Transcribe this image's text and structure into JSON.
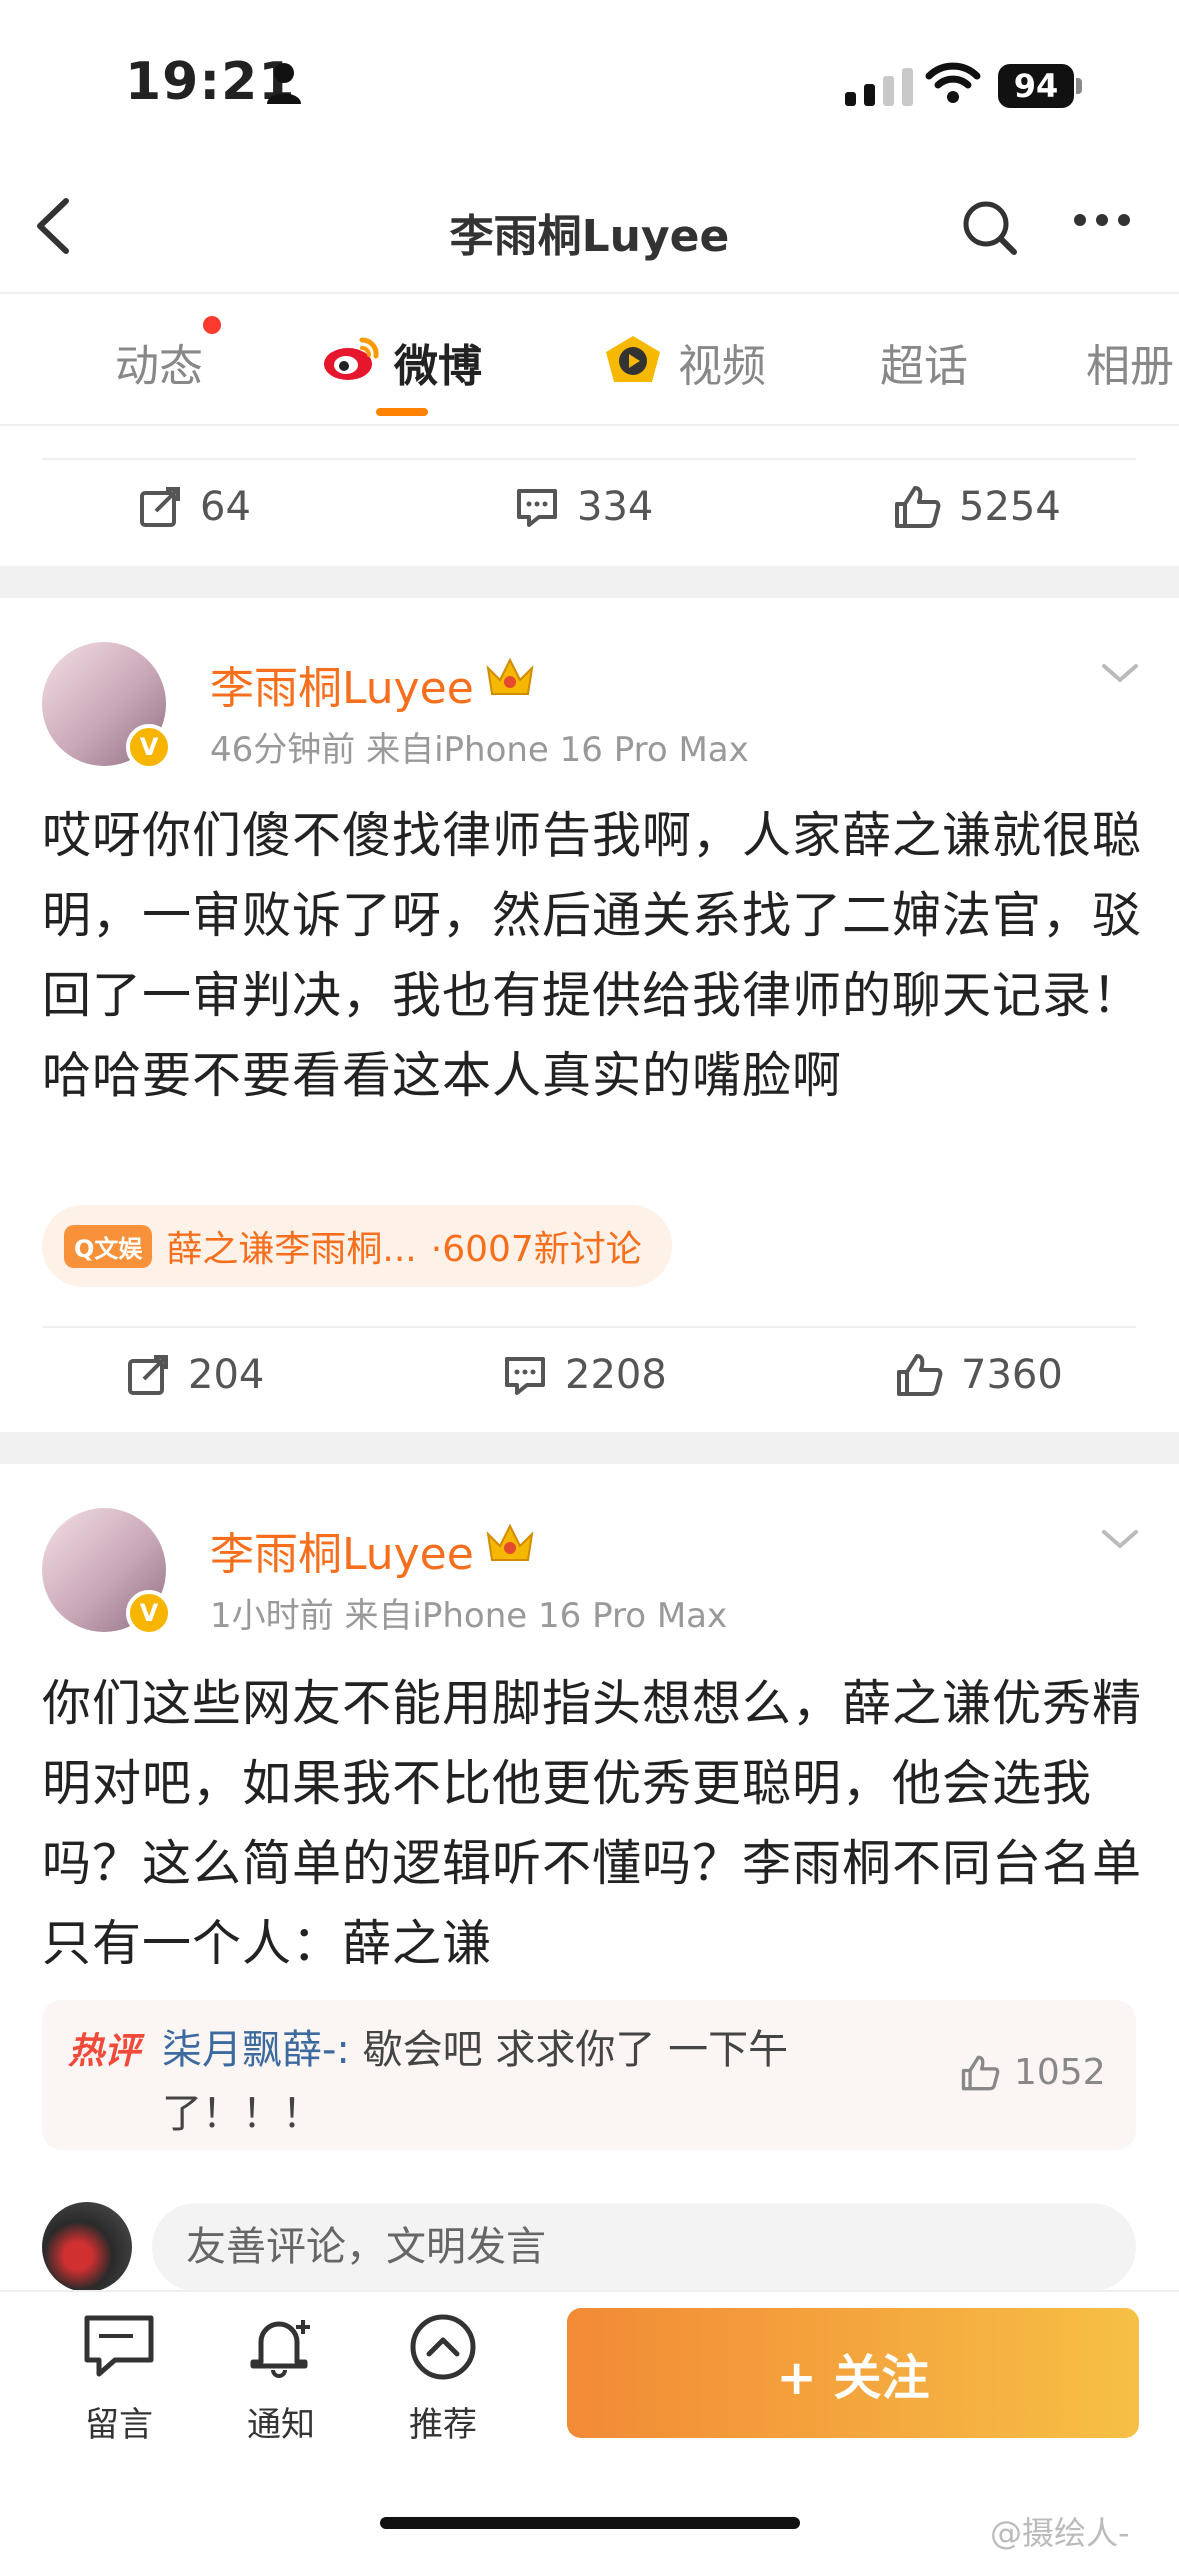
{
  "status_bar": {
    "time": "19:21",
    "battery": "94"
  },
  "nav": {
    "title": "李雨桐Luyee"
  },
  "tabs": [
    {
      "label": "动态"
    },
    {
      "label": "微博"
    },
    {
      "label": "视频"
    },
    {
      "label": "超话"
    },
    {
      "label": "相册"
    }
  ],
  "prev_post": {
    "reposts": "64",
    "comments": "334",
    "likes": "5254"
  },
  "post1": {
    "username": "李雨桐Luyee",
    "meta": "46分钟前  来自iPhone 16 Pro Max",
    "text": "哎呀你们傻不傻找律师告我啊，人家薛之谦就很聪明，一审败诉了呀，然后通关系找了二婶法官，驳回了一审判决，我也有提供给我律师的聊天记录！哈哈要不要看看这本人真实的嘴脸啊",
    "topic_tag": "Q文娱",
    "topic_title": "薛之谦李雨桐...",
    "topic_count": "·6007新讨论",
    "reposts": "204",
    "comments": "2208",
    "likes": "7360"
  },
  "post2": {
    "username": "李雨桐Luyee",
    "meta": "1小时前  来自iPhone 16 Pro Max",
    "text": "你们这些网友不能用脚指头想想么，薛之谦优秀精明对吧，如果我不比他更优秀更聪明，他会选我吗？这么简单的逻辑听不懂吗？李雨桐不同台名单只有一个人：薛之谦",
    "hot_label": "热评",
    "hot_user": "柒月飘薛-:",
    "hot_text": " 歇会吧 求求你了 一下午了！！！",
    "hot_likes": "1052"
  },
  "comment_input": {
    "placeholder": "友善评论，文明发言"
  },
  "bottom_bar": {
    "message": "留言",
    "notify": "通知",
    "recommend": "推荐",
    "follow": "+ 关注"
  },
  "watermark": "@摄绘人-"
}
